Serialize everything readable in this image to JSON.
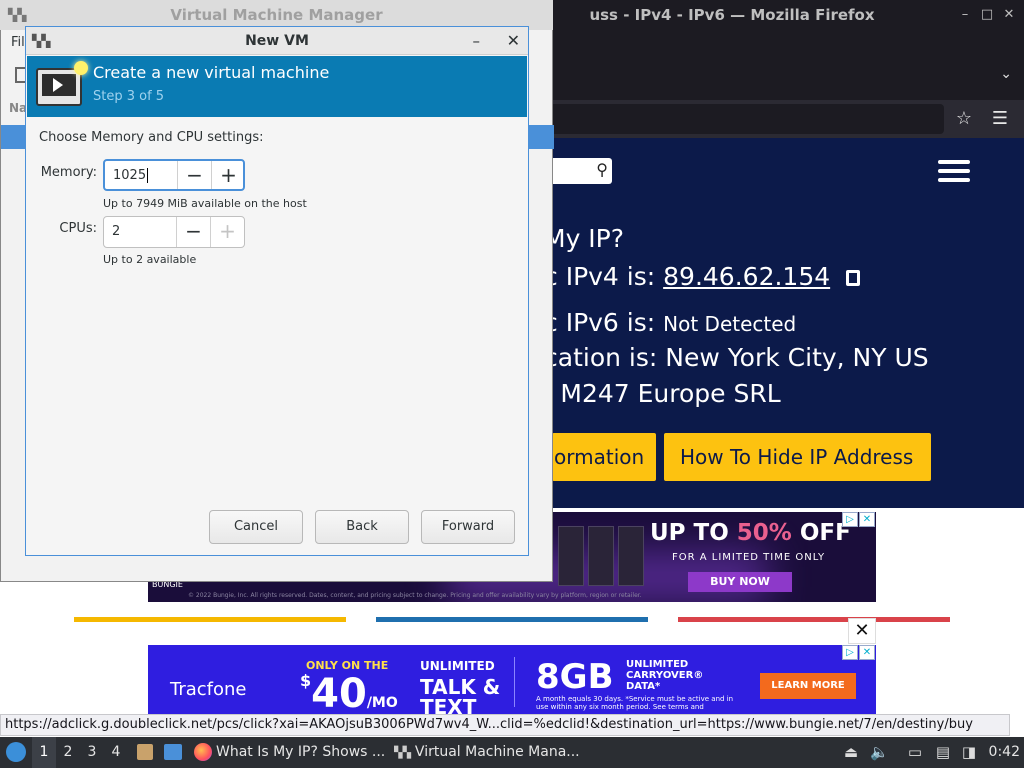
{
  "firefox": {
    "title": "uss - IPv4 - IPv6 — Mozilla Firefox",
    "page": {
      "line1": "My IP?",
      "line2_prefix": "c IPv4 is: ",
      "ipv4": "89.46.62.154",
      "line3_prefix": "c IPv6 is: ",
      "ipv6": "Not Detected",
      "line4": "cation is: New York City, NY US",
      "line5": ": M247 Europe SRL",
      "btn_info": "ormation",
      "btn_hide": "How To Hide IP Address"
    },
    "ad1": {
      "headline_a": "UP TO ",
      "headline_pct": "50%",
      "headline_b": " OFF",
      "sub": "FOR A LIMITED TIME ONLY",
      "cta": "BUY NOW",
      "brand": "BUNGIE",
      "fine": "© 2022 Bungie, Inc. All rights reserved. Dates, content, and pricing subject to change. Pricing and offer availability vary by platform, region or retailer."
    },
    "ad2": {
      "logo": "Tracfone",
      "only": "ONLY ON THE",
      "price_dollar": "$",
      "price": "40",
      "price_unit": "/MO",
      "unlimited": "UNLIMITED",
      "talk_text": "TALK & TEXT",
      "data_amount": "8GB",
      "carryover": "UNLIMITED CARRYOVER® DATA*",
      "fine": "A month equals 30 days. *Service must be active and in use within any six month period. See terms and",
      "cta": "LEARN MORE"
    },
    "status_url": "https://adclick.g.doubleclick.net/pcs/click?xai=AKAOjsuB3006PWd7wv4_W...clid=%edclid!&destination_url=https://www.bungie.net/7/en/destiny/buy"
  },
  "vmm": {
    "title": "Virtual Machine Manager",
    "menu_peek": "Fil",
    "name_peek": "Na"
  },
  "dialog": {
    "title": "New VM",
    "banner_title": "Create a new virtual machine",
    "banner_step": "Step 3 of 5",
    "section_label": "Choose Memory and CPU settings:",
    "memory_label": "Memory:",
    "memory_value": "1025",
    "memory_hint": "Up to 7949 MiB available on the host",
    "cpus_label": "CPUs:",
    "cpus_value": "2",
    "cpus_hint": "Up to 2 available",
    "cancel": "Cancel",
    "back": "Back",
    "forward": "Forward"
  },
  "taskbar": {
    "workspaces": [
      "1",
      "2",
      "3",
      "4"
    ],
    "task_firefox": "What Is My IP? Shows ...",
    "task_vmm": "Virtual Machine Mana...",
    "clock": "0:42"
  },
  "icons": {
    "minimize": "minimize-icon",
    "close": "close-icon",
    "search": "search-icon",
    "bookmark": "star-icon",
    "menu": "hamburger-icon"
  },
  "colors": {
    "banner": "#0a7bb3",
    "focus_ring": "#4a90d9",
    "site_bg": "#0c1a4a",
    "site_button": "#fdc210"
  }
}
